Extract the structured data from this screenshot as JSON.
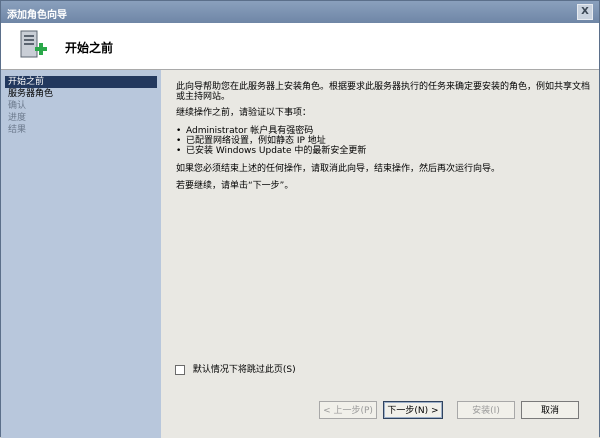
{
  "window": {
    "title": "添加角色向导",
    "close_glyph": "X"
  },
  "header": {
    "heading": "开始之前",
    "icon": "server-role-add-icon"
  },
  "nav": {
    "items": [
      {
        "label": "开始之前",
        "state": "active"
      },
      {
        "label": "服务器角色",
        "state": "normal"
      },
      {
        "label": "确认",
        "state": "disabled"
      },
      {
        "label": "进度",
        "state": "disabled"
      },
      {
        "label": "结果",
        "state": "disabled"
      }
    ]
  },
  "content": {
    "intro": "此向导帮助您在此服务器上安装角色。根据要求此服务器执行的任务来确定要安装的角色，例如共享文档或主持网站。",
    "verify_heading": "继续操作之前，请验证以下事项：",
    "bullets": [
      "Administrator 帐户具有强密码",
      "已配置网络设置，例如静态 IP 地址",
      "已安装 Windows Update 中的最新安全更新"
    ],
    "cancel_note": "如果您必须结束上述的任何操作，请取消此向导，结束操作，然后再次运行向导。",
    "continue_note": "若要继续，请单击“下一步”。",
    "skip_label": "默认情况下将跳过此页(S)"
  },
  "buttons": {
    "prev": "< 上一步(P)",
    "next": "下一步(N) >",
    "install": "安装(I)",
    "cancel": "取消"
  }
}
